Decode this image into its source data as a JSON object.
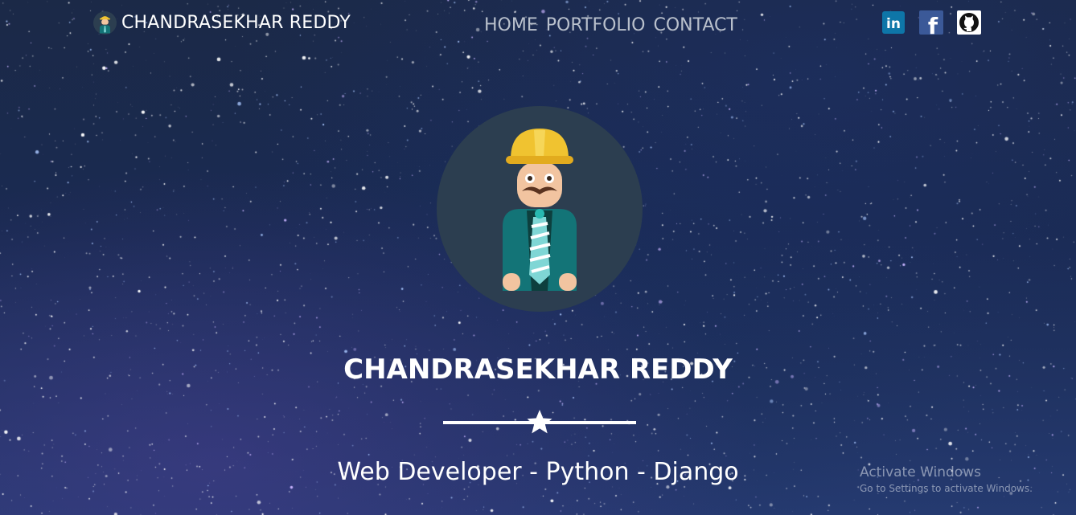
{
  "navbar": {
    "brand_title": "CHANDRASEKHAR REDDY",
    "links": [
      {
        "label": "HOME"
      },
      {
        "label": "PORTFOLIO"
      },
      {
        "label": "CONTACT"
      }
    ],
    "social": [
      {
        "icon": "linkedin-icon",
        "label": "in",
        "color": "#0e76a8"
      },
      {
        "icon": "facebook-icon",
        "label": "f",
        "color": "#3b5998"
      },
      {
        "icon": "github-icon",
        "color": "#ffffff"
      }
    ]
  },
  "hero": {
    "avatar_icon": "engineer-avatar-icon",
    "title": "CHANDRASEKHAR REDDY",
    "divider_icon": "star-icon",
    "subtitle": "Web Developer - Python - Django"
  },
  "watermark": {
    "title": "Activate Windows",
    "subtitle": "Go to Settings to activate Windows."
  },
  "colors": {
    "avatar_bg": "#2c3e50",
    "helmet": "#f0c330",
    "jacket": "#137477",
    "skin": "#f2c4a0",
    "tie": "#7fd6d5"
  }
}
